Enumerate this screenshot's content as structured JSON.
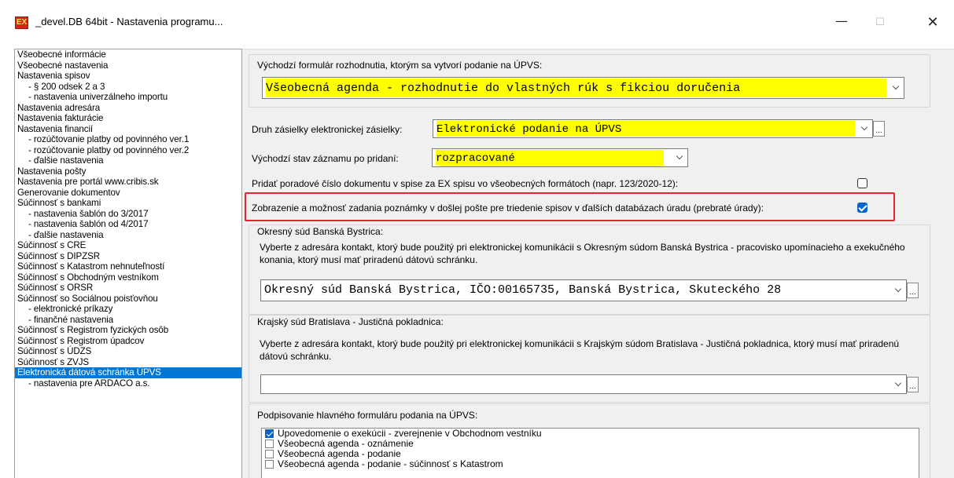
{
  "window": {
    "icon_text": "EX",
    "title": "_devel.DB 64bit - Nastavenia programu...",
    "minimize_glyph": "—",
    "maximize_glyph": "☐",
    "close_glyph": "✕"
  },
  "tree": {
    "items": [
      {
        "label": "Všeobecné informácie",
        "level": 0
      },
      {
        "label": "Všeobecné nastavenia",
        "level": 0
      },
      {
        "label": "Nastavenia spisov",
        "level": 0
      },
      {
        "label": "- § 200 odsek 2 a 3",
        "level": 1
      },
      {
        "label": "- nastavenia univerzálneho importu",
        "level": 1
      },
      {
        "label": "Nastavenia adresára",
        "level": 0
      },
      {
        "label": "Nastavenia fakturácie",
        "level": 0
      },
      {
        "label": "Nastavenia financií",
        "level": 0
      },
      {
        "label": "- rozúčtovanie platby od povinného ver.1",
        "level": 1
      },
      {
        "label": "- rozúčtovanie platby od povinného ver.2",
        "level": 1
      },
      {
        "label": "- ďalšie nastavenia",
        "level": 1
      },
      {
        "label": "Nastavenia pošty",
        "level": 0
      },
      {
        "label": "Nastavenia pre portál www.cribis.sk",
        "level": 0
      },
      {
        "label": "Generovanie dokumentov",
        "level": 0
      },
      {
        "label": "Súčinnosť s bankami",
        "level": 0
      },
      {
        "label": "- nastavenia šablón do 3/2017",
        "level": 1
      },
      {
        "label": "- nastavenia šablón od 4/2017",
        "level": 1
      },
      {
        "label": "- ďalšie nastavenia",
        "level": 1
      },
      {
        "label": "Súčinnosť s CRE",
        "level": 0
      },
      {
        "label": "Súčinnosť s DIPZSR",
        "level": 0
      },
      {
        "label": "Súčinnosť s Katastrom nehnuteľností",
        "level": 0
      },
      {
        "label": "Súčinnosť s Obchodným vestníkom",
        "level": 0
      },
      {
        "label": "Súčinnosť s ORSR",
        "level": 0
      },
      {
        "label": "Súčinnosť so Sociálnou poisťovňou",
        "level": 0
      },
      {
        "label": "- elektronické príkazy",
        "level": 1
      },
      {
        "label": "- finančné nastavenia",
        "level": 1
      },
      {
        "label": "Súčinnosť s Registrom fyzických osôb",
        "level": 0
      },
      {
        "label": "Súčinnosť s Registrom úpadcov",
        "level": 0
      },
      {
        "label": "Súčinnosť s ÚDZS",
        "level": 0
      },
      {
        "label": "Súčinnosť s ZVJS",
        "level": 0
      },
      {
        "label": "Elektronická dátová schránka ÚPVS",
        "level": 0,
        "selected": true
      },
      {
        "label": "- nastavenia pre ARDACO a.s.",
        "level": 1
      }
    ]
  },
  "settings": {
    "default_form": {
      "group_title": "Východzí formulár rozhodnutia, ktorým sa vytvorí podanie na ÚPVS:",
      "value": "Všeobecná agenda - rozhodnutie do vlastných rúk s fikciou doručenia"
    },
    "shipment_type": {
      "label": "Druh zásielky elektronickej zásielky:",
      "value": "Elektronické podanie na ÚPVS",
      "ellipsis": "..."
    },
    "default_state": {
      "label": "Východzí stav záznamu po pridaní:",
      "value": "rozpracované"
    },
    "add_order_number": {
      "label": "Pridať poradové číslo dokumentu v spise za EX spisu vo všeobecných formátoch (napr. 123/2020-12):",
      "checked": false
    },
    "show_note": {
      "label": "Zobrazenie a možnosť zadania poznámky v došlej pošte pre triedenie spisov v ďalších databázach úradu (prebraté úrady):",
      "checked": true
    },
    "district_court": {
      "group_title": "Okresný súd Banská Bystrica:",
      "description": "Vyberte z adresára kontakt, ktorý bude použitý pri elektronickej komunikácii s Okresným súdom Banská Bystrica - pracovisko upomínacieho a exekučného konania, ktorý musí mať priradenú dátovú schránku.",
      "value": "Okresný súd Banská Bystrica, IČO:00165735, Banská Bystrica, Skuteckého 28",
      "ellipsis": "..."
    },
    "regional_court": {
      "group_title": "Krajský súd Bratislava - Justičná pokladnica:",
      "description": "Vyberte z adresára kontakt, ktorý bude použitý pri elektronickej komunikácii s Krajským súdom Bratislava - Justičná pokladnica, ktorý musí mať priradenú dátovú schránku.",
      "value": "",
      "ellipsis": "..."
    },
    "signing": {
      "group_title": "Podpisovanie hlavného formuláru podania na ÚPVS:",
      "items": [
        {
          "label": "Upovedomenie o exekúcii - zverejnenie v Obchodnom vestníku",
          "checked": true
        },
        {
          "label": "Všeobecná agenda - oznámenie",
          "checked": false
        },
        {
          "label": "Všeobecná agenda - podanie",
          "checked": false
        },
        {
          "label": "Všeobecná agenda - podanie - súčinnosť s Katastrom",
          "checked": false
        }
      ]
    }
  },
  "colors": {
    "selection": "#0078d7",
    "highlight_field": "#ffff00",
    "annotation_box": "#e0262e",
    "checkbox_checked": "#0a64c8"
  }
}
